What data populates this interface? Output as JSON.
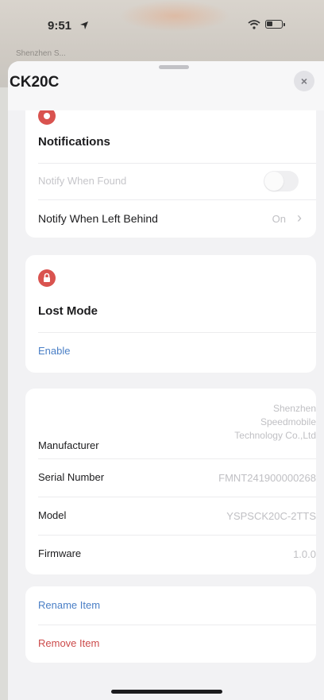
{
  "status_bar": {
    "time": "9:51"
  },
  "map": {
    "label_left": "Shenzhen S...",
    "label_center": "..."
  },
  "sheet": {
    "title": "CK20C",
    "close_symbol": "×"
  },
  "notifications": {
    "title": "Notifications",
    "notify_when_found": {
      "label": "Notify When Found",
      "toggle_on": false
    },
    "notify_when_left_behind": {
      "label": "Notify When Left Behind",
      "value": "On",
      "chevron": "›"
    }
  },
  "lost_mode": {
    "title": "Lost Mode",
    "enable_label": "Enable"
  },
  "info": {
    "manufacturer": {
      "label": "Manufacturer",
      "value_line1": "Shenzhen",
      "value_line2": "Speedmobile",
      "value_line3": "Technology Co.,Ltd"
    },
    "serial_number": {
      "label": "Serial Number",
      "value": "FMNT241900000268"
    },
    "model": {
      "label": "Model",
      "value": "YSPSCK20C-2TTS"
    },
    "firmware": {
      "label": "Firmware",
      "value": "1.0.0"
    }
  },
  "actions": {
    "rename_label": "Rename Item",
    "remove_label": "Remove Item"
  },
  "colors": {
    "accent_blue": "#4a7fc6",
    "destructive_red": "#cc4b4b",
    "section_icon_red": "#d9534f"
  },
  "icons": {
    "location": "location-arrow-icon",
    "wifi": "wifi-icon",
    "battery": "battery-icon",
    "notifications": "bell-section-icon",
    "lost_mode": "lock-section-icon",
    "close": "close-icon"
  }
}
